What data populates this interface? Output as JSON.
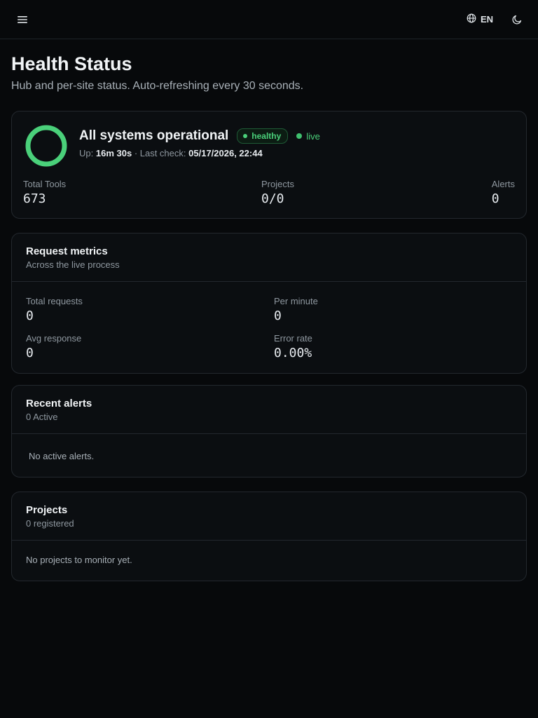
{
  "topbar": {
    "menu_icon": "hamburger-menu-icon",
    "language": "EN",
    "language_icon": "globe-icon",
    "theme_icon": "moon-icon"
  },
  "header": {
    "title": "Health Status",
    "subtitle": "Hub and per-site status. Auto-refreshing every 30 seconds."
  },
  "status": {
    "headline": "All systems operational",
    "badge": "healthy",
    "live_label": "live",
    "uptime_label": "Up:",
    "uptime_value": "16m 30s",
    "last_check_label": "· Last check:",
    "last_check_value": "05/17/2026, 22:44",
    "ring_color": "#4ad07a",
    "stats": {
      "total_tools_label": "Total Tools",
      "total_tools_value": "673",
      "projects_label": "Projects",
      "projects_value": "0/0",
      "alerts_label": "Alerts",
      "alerts_value": "0"
    }
  },
  "metrics": {
    "title": "Request metrics",
    "subtitle": "Across the live process",
    "total_requests_label": "Total requests",
    "total_requests_value": "0",
    "per_minute_label": "Per minute",
    "per_minute_value": "0",
    "avg_response_label": "Avg response",
    "avg_response_value": "0",
    "error_rate_label": "Error rate",
    "error_rate_value": "0.00%"
  },
  "alerts": {
    "title": "Recent alerts",
    "subtitle": "0 Active",
    "empty": "No active alerts."
  },
  "projects": {
    "title": "Projects",
    "subtitle": "0 registered",
    "empty": "No projects to monitor yet."
  }
}
